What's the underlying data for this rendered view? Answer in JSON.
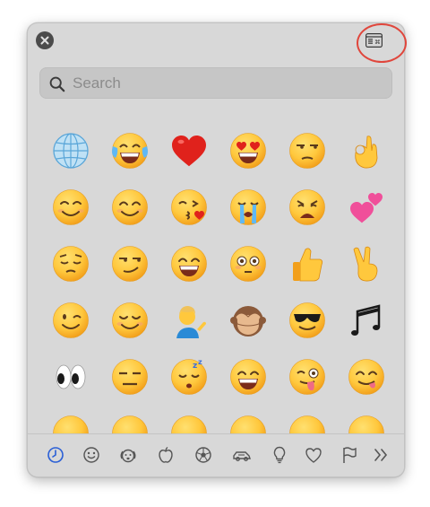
{
  "search": {
    "placeholder": "Search"
  },
  "colors": {
    "face": "#ffc83d",
    "face_shade": "#f29f1b",
    "heart": "#e0221c",
    "ring": "#e0463c",
    "accent": "#2a5fd6"
  },
  "emojis": [
    "globe-with-meridians",
    "face-with-tears-of-joy",
    "red-heart",
    "smiling-face-with-heart-eyes",
    "unamused-face",
    "ok-hand",
    "smiling-face",
    "smiling-face-with-smiling-eyes",
    "face-blowing-a-kiss",
    "loudly-crying-face",
    "weary-face",
    "two-hearts",
    "pensive-face",
    "smirking-face",
    "beaming-face-with-smiling-eyes",
    "flushed-face",
    "thumbs-up",
    "victory-hand",
    "winking-face",
    "relieved-face",
    "person-tipping-hand",
    "see-no-evil-monkey",
    "smiling-face-with-sunglasses",
    "musical-notes",
    "eyes",
    "expressionless-face",
    "sleeping-face",
    "grinning-face-with-smiling-eyes",
    "winking-face-with-tongue",
    "face-savoring-food",
    "face",
    "face",
    "face",
    "face",
    "face",
    "face"
  ],
  "categories": [
    {
      "icon": "clock-icon",
      "selected": true
    },
    {
      "icon": "smiley-icon",
      "selected": false
    },
    {
      "icon": "dog-face-icon",
      "selected": false
    },
    {
      "icon": "apple-icon",
      "selected": false
    },
    {
      "icon": "soccer-ball-icon",
      "selected": false
    },
    {
      "icon": "car-icon",
      "selected": false
    },
    {
      "icon": "lightbulb-icon",
      "selected": false
    },
    {
      "icon": "heart-icon",
      "selected": false
    },
    {
      "icon": "flag-icon",
      "selected": false
    },
    {
      "icon": "chevron-double-right-icon",
      "selected": false
    }
  ]
}
